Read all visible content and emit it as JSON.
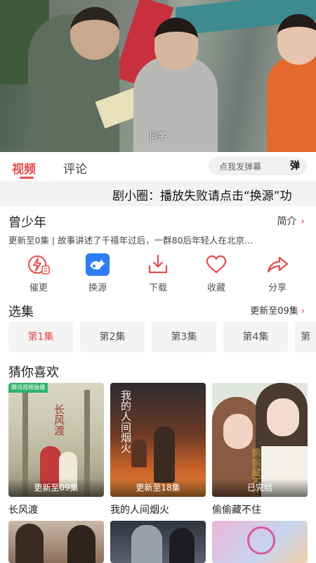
{
  "player": {
    "subtitle": "同学"
  },
  "tabs": {
    "video": "视频",
    "comments": "评论"
  },
  "danmaku": {
    "placeholder": "点我发弹幕",
    "button": "弹"
  },
  "marquee": {
    "text": "剧小圈：播放失败请点击“换源”功"
  },
  "show": {
    "title": "曾少年",
    "intro_label": "简介",
    "description": "更新至0集 | 故事讲述了千禧年过后，一群80后年轻人在北京…"
  },
  "actions": [
    {
      "label": "催更",
      "icon": "urge-update-icon"
    },
    {
      "label": "换源",
      "icon": "switch-source-icon"
    },
    {
      "label": "下载",
      "icon": "download-icon"
    },
    {
      "label": "收藏",
      "icon": "heart-icon"
    },
    {
      "label": "分享",
      "icon": "share-icon"
    }
  ],
  "episodes": {
    "title": "选集",
    "update_status": "更新至09集",
    "items": [
      "第1集",
      "第2集",
      "第3集",
      "第4集",
      "第"
    ],
    "selected": 0
  },
  "recommend": {
    "title": "猜你喜欢",
    "items": [
      {
        "title": "长风渡",
        "badge": "更新至09集",
        "tag": "腾讯视频独播",
        "poster_text": "长风渡"
      },
      {
        "title": "我的人间烟火",
        "badge": "更新至18集",
        "poster_text": "我的人间烟火"
      },
      {
        "title": "偷偷藏不住",
        "badge": "已完结",
        "poster_text": "偷偷藏不住"
      }
    ]
  },
  "colors": {
    "accent": "#e64c4c",
    "source_blue": "#2e7cf6"
  }
}
